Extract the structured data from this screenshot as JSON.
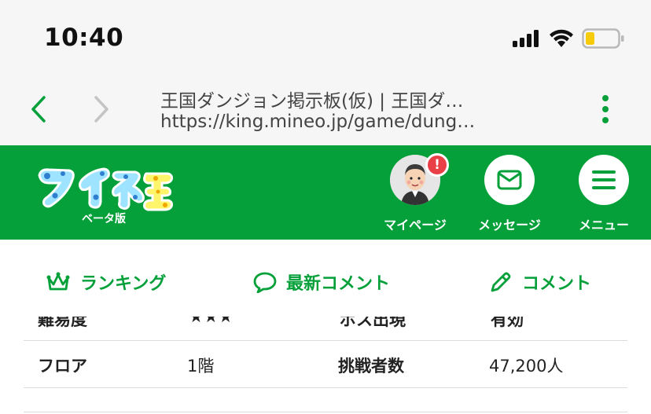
{
  "status": {
    "time": "10:40"
  },
  "browser": {
    "title": "王国ダンジョン掲示板(仮) | 王国ダ…",
    "url": "https://king.mineo.jp/game/dung…"
  },
  "header": {
    "beta_label": "ベータ版",
    "mypage_label": "マイページ",
    "message_label": "メッセージ",
    "menu_label": "メニュー",
    "alert_mark": "!"
  },
  "tabs": [
    {
      "label": "ランキング",
      "icon": "crown-icon"
    },
    {
      "label": "最新コメント",
      "icon": "speech-bubble-icon"
    },
    {
      "label": "コメント",
      "icon": "pencil-icon"
    }
  ],
  "table": {
    "partial_row": [
      "難易度",
      "★★★",
      "ボス出現",
      "有効"
    ],
    "rows": [
      {
        "label1": "フロア",
        "value1": "1階",
        "label2": "挑戦者数",
        "value2": "47,200人"
      }
    ]
  },
  "colors": {
    "brand": "#05a03a",
    "alert": "#e94047",
    "ios_blue_green": "#05a03a"
  }
}
